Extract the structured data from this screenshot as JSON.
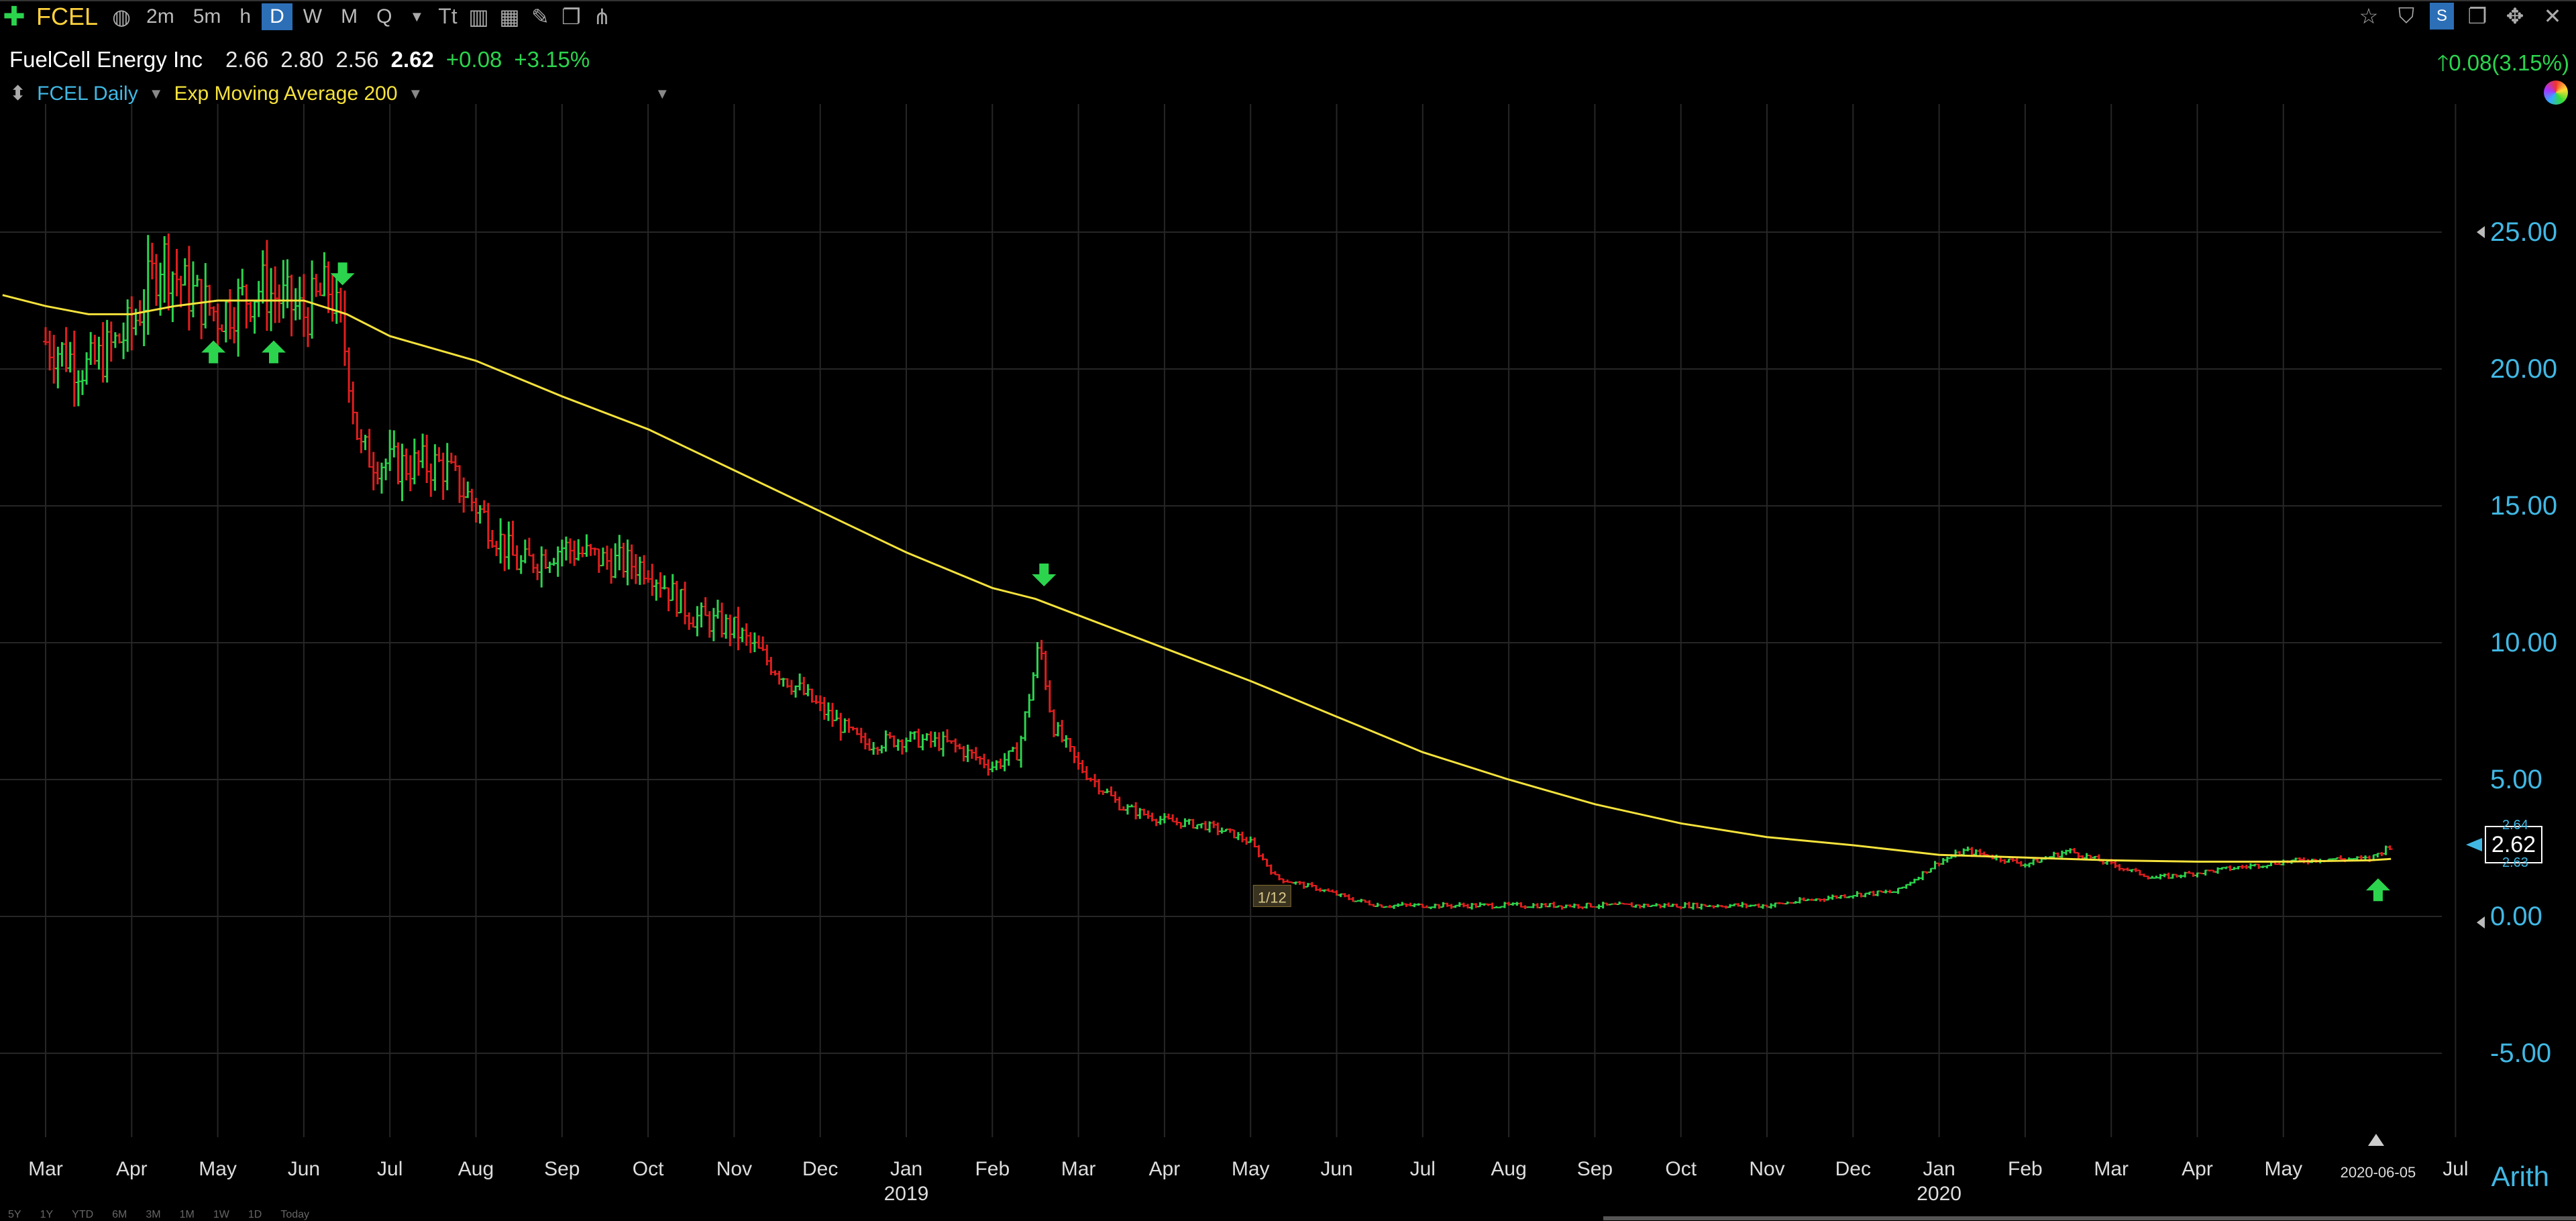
{
  "toolbar": {
    "symbol": "FCEL",
    "intervals": [
      {
        "label": "2m",
        "active": false
      },
      {
        "label": "5m",
        "active": false
      },
      {
        "label": "h",
        "active": false
      },
      {
        "label": "D",
        "active": true
      },
      {
        "label": "W",
        "active": false
      },
      {
        "label": "M",
        "active": false
      },
      {
        "label": "Q",
        "active": false
      }
    ]
  },
  "quote": {
    "name": "FuelCell Energy Inc",
    "open": "2.66",
    "high": "2.80",
    "low": "2.56",
    "last": "2.62",
    "change": "+0.08",
    "change_pct": "+3.15%",
    "right_change": "0.08(3.15%)"
  },
  "legend": {
    "series_label": "FCEL Daily",
    "indicator_label": "Exp Moving Average 200"
  },
  "colors": {
    "up": "#2cd44e",
    "down": "#e01e1e",
    "ema": "#f5e23c",
    "axis": "#41b8e4",
    "grid": "#262626"
  },
  "chart_data": {
    "type": "candlestick",
    "series": [
      {
        "name": "FCEL Daily",
        "kind": "price"
      },
      {
        "name": "Exp Moving Average 200",
        "kind": "line"
      }
    ],
    "ylim": [
      -8.2,
      29.2
    ],
    "y_ticks": [
      "25.00",
      "20.00",
      "15.00",
      "10.00",
      "5.00",
      "0.00",
      "-5.00"
    ],
    "y_tick_values": [
      25,
      20,
      15,
      10,
      5,
      0,
      -5
    ],
    "month_labels": [
      {
        "label": "Mar",
        "m": 0
      },
      {
        "label": "Apr",
        "m": 1
      },
      {
        "label": "May",
        "m": 2
      },
      {
        "label": "Jun",
        "m": 3
      },
      {
        "label": "Jul",
        "m": 4
      },
      {
        "label": "Aug",
        "m": 5
      },
      {
        "label": "Sep",
        "m": 6
      },
      {
        "label": "Oct",
        "m": 7
      },
      {
        "label": "Nov",
        "m": 8
      },
      {
        "label": "Dec",
        "m": 9
      },
      {
        "label": "Jan",
        "m": 10
      },
      {
        "label": "Feb",
        "m": 11
      },
      {
        "label": "Mar",
        "m": 12
      },
      {
        "label": "Apr",
        "m": 13
      },
      {
        "label": "May",
        "m": 14
      },
      {
        "label": "Jun",
        "m": 15
      },
      {
        "label": "Jul",
        "m": 16
      },
      {
        "label": "Aug",
        "m": 17
      },
      {
        "label": "Sep",
        "m": 18
      },
      {
        "label": "Oct",
        "m": 19
      },
      {
        "label": "Nov",
        "m": 20
      },
      {
        "label": "Dec",
        "m": 21
      },
      {
        "label": "Jan",
        "m": 22
      },
      {
        "label": "Feb",
        "m": 23
      },
      {
        "label": "Mar",
        "m": 24
      },
      {
        "label": "Apr",
        "m": 25
      },
      {
        "label": "May",
        "m": 26
      },
      {
        "label": "Jul",
        "m": 28
      }
    ],
    "year_labels": [
      {
        "label": "2019",
        "m": 10
      },
      {
        "label": "2020",
        "m": 22
      }
    ],
    "date_label": {
      "label": "2020-06-05",
      "m": 27.1
    },
    "price_path": [
      [
        0,
        21.0
      ],
      [
        0.5,
        20.0
      ],
      [
        1.0,
        21.5
      ],
      [
        1.35,
        24.2
      ],
      [
        1.6,
        23.0
      ],
      [
        2.0,
        22.0
      ],
      [
        2.5,
        23.0
      ],
      [
        3.0,
        22.0
      ],
      [
        3.3,
        23.0
      ],
      [
        3.5,
        20.5
      ],
      [
        3.65,
        17.0
      ],
      [
        4.0,
        16.5
      ],
      [
        4.6,
        16.5
      ],
      [
        5.0,
        15.0
      ],
      [
        5.5,
        12.8
      ],
      [
        6.0,
        13.5
      ],
      [
        6.5,
        13.0
      ],
      [
        7.0,
        12.8
      ],
      [
        7.5,
        11.0
      ],
      [
        8.0,
        10.5
      ],
      [
        8.5,
        9.0
      ],
      [
        9.0,
        7.6
      ],
      [
        9.5,
        6.3
      ],
      [
        10.0,
        6.5
      ],
      [
        10.5,
        6.3
      ],
      [
        11.0,
        5.5
      ],
      [
        11.3,
        6.0
      ],
      [
        11.55,
        10.0
      ],
      [
        11.7,
        7.0
      ],
      [
        12.0,
        5.5
      ],
      [
        12.5,
        4.0
      ],
      [
        13.0,
        3.5
      ],
      [
        13.5,
        3.3
      ],
      [
        13.8,
        3.0
      ],
      [
        14.0,
        2.7
      ],
      [
        14.3,
        1.4
      ],
      [
        14.8,
        1.0
      ],
      [
        15.2,
        0.6
      ],
      [
        15.5,
        0.4
      ],
      [
        16.0,
        0.4
      ],
      [
        17.0,
        0.4
      ],
      [
        18.0,
        0.4
      ],
      [
        19.0,
        0.4
      ],
      [
        20.0,
        0.4
      ],
      [
        20.5,
        0.6
      ],
      [
        21.0,
        0.8
      ],
      [
        21.5,
        0.9
      ],
      [
        22.0,
        2.0
      ],
      [
        22.3,
        2.4
      ],
      [
        22.6,
        2.2
      ],
      [
        23.0,
        1.9
      ],
      [
        23.5,
        2.4
      ],
      [
        24.0,
        1.9
      ],
      [
        24.5,
        1.4
      ],
      [
        25.0,
        1.6
      ],
      [
        25.5,
        1.8
      ],
      [
        26.0,
        2.0
      ],
      [
        26.5,
        2.1
      ],
      [
        27.0,
        2.1
      ],
      [
        27.25,
        2.6
      ]
    ],
    "ema_points": [
      [
        -0.5,
        22.7
      ],
      [
        0.0,
        22.3
      ],
      [
        0.5,
        22.0
      ],
      [
        1.0,
        22.0
      ],
      [
        1.5,
        22.3
      ],
      [
        2.0,
        22.5
      ],
      [
        2.5,
        22.5
      ],
      [
        3.0,
        22.5
      ],
      [
        3.5,
        22.0
      ],
      [
        4.0,
        21.2
      ],
      [
        5.0,
        20.3
      ],
      [
        6.0,
        19.0
      ],
      [
        7.0,
        17.8
      ],
      [
        8.0,
        16.3
      ],
      [
        9.0,
        14.8
      ],
      [
        10.0,
        13.3
      ],
      [
        11.0,
        12.0
      ],
      [
        11.5,
        11.6
      ],
      [
        12.0,
        11.0
      ],
      [
        13.0,
        9.8
      ],
      [
        14.0,
        8.6
      ],
      [
        15.0,
        7.3
      ],
      [
        16.0,
        6.0
      ],
      [
        17.0,
        5.0
      ],
      [
        18.0,
        4.1
      ],
      [
        19.0,
        3.4
      ],
      [
        20.0,
        2.9
      ],
      [
        21.0,
        2.6
      ],
      [
        22.0,
        2.25
      ],
      [
        23.0,
        2.15
      ],
      [
        24.0,
        2.05
      ],
      [
        25.0,
        2.0
      ],
      [
        26.0,
        2.0
      ],
      [
        27.0,
        2.05
      ],
      [
        27.25,
        2.1
      ]
    ],
    "signals": [
      {
        "dir": "up",
        "m": 1.95,
        "price": 20.6
      },
      {
        "dir": "up",
        "m": 2.65,
        "price": 20.6
      },
      {
        "dir": "down",
        "m": 3.45,
        "price": 23.5
      },
      {
        "dir": "down",
        "m": 11.6,
        "price": 12.5
      },
      {
        "dir": "up",
        "m": 27.1,
        "price": 0.95
      }
    ],
    "annotation": {
      "label": "1/12",
      "m": 14.25,
      "price": 0.7
    },
    "last_price": "2.62",
    "bid_label": "2.64",
    "ask_label": "2.63",
    "scale_mode": "Arith"
  },
  "range_buttons": [
    "5Y",
    "1Y",
    "YTD",
    "6M",
    "3M",
    "1M",
    "1W",
    "1D",
    "Today"
  ]
}
